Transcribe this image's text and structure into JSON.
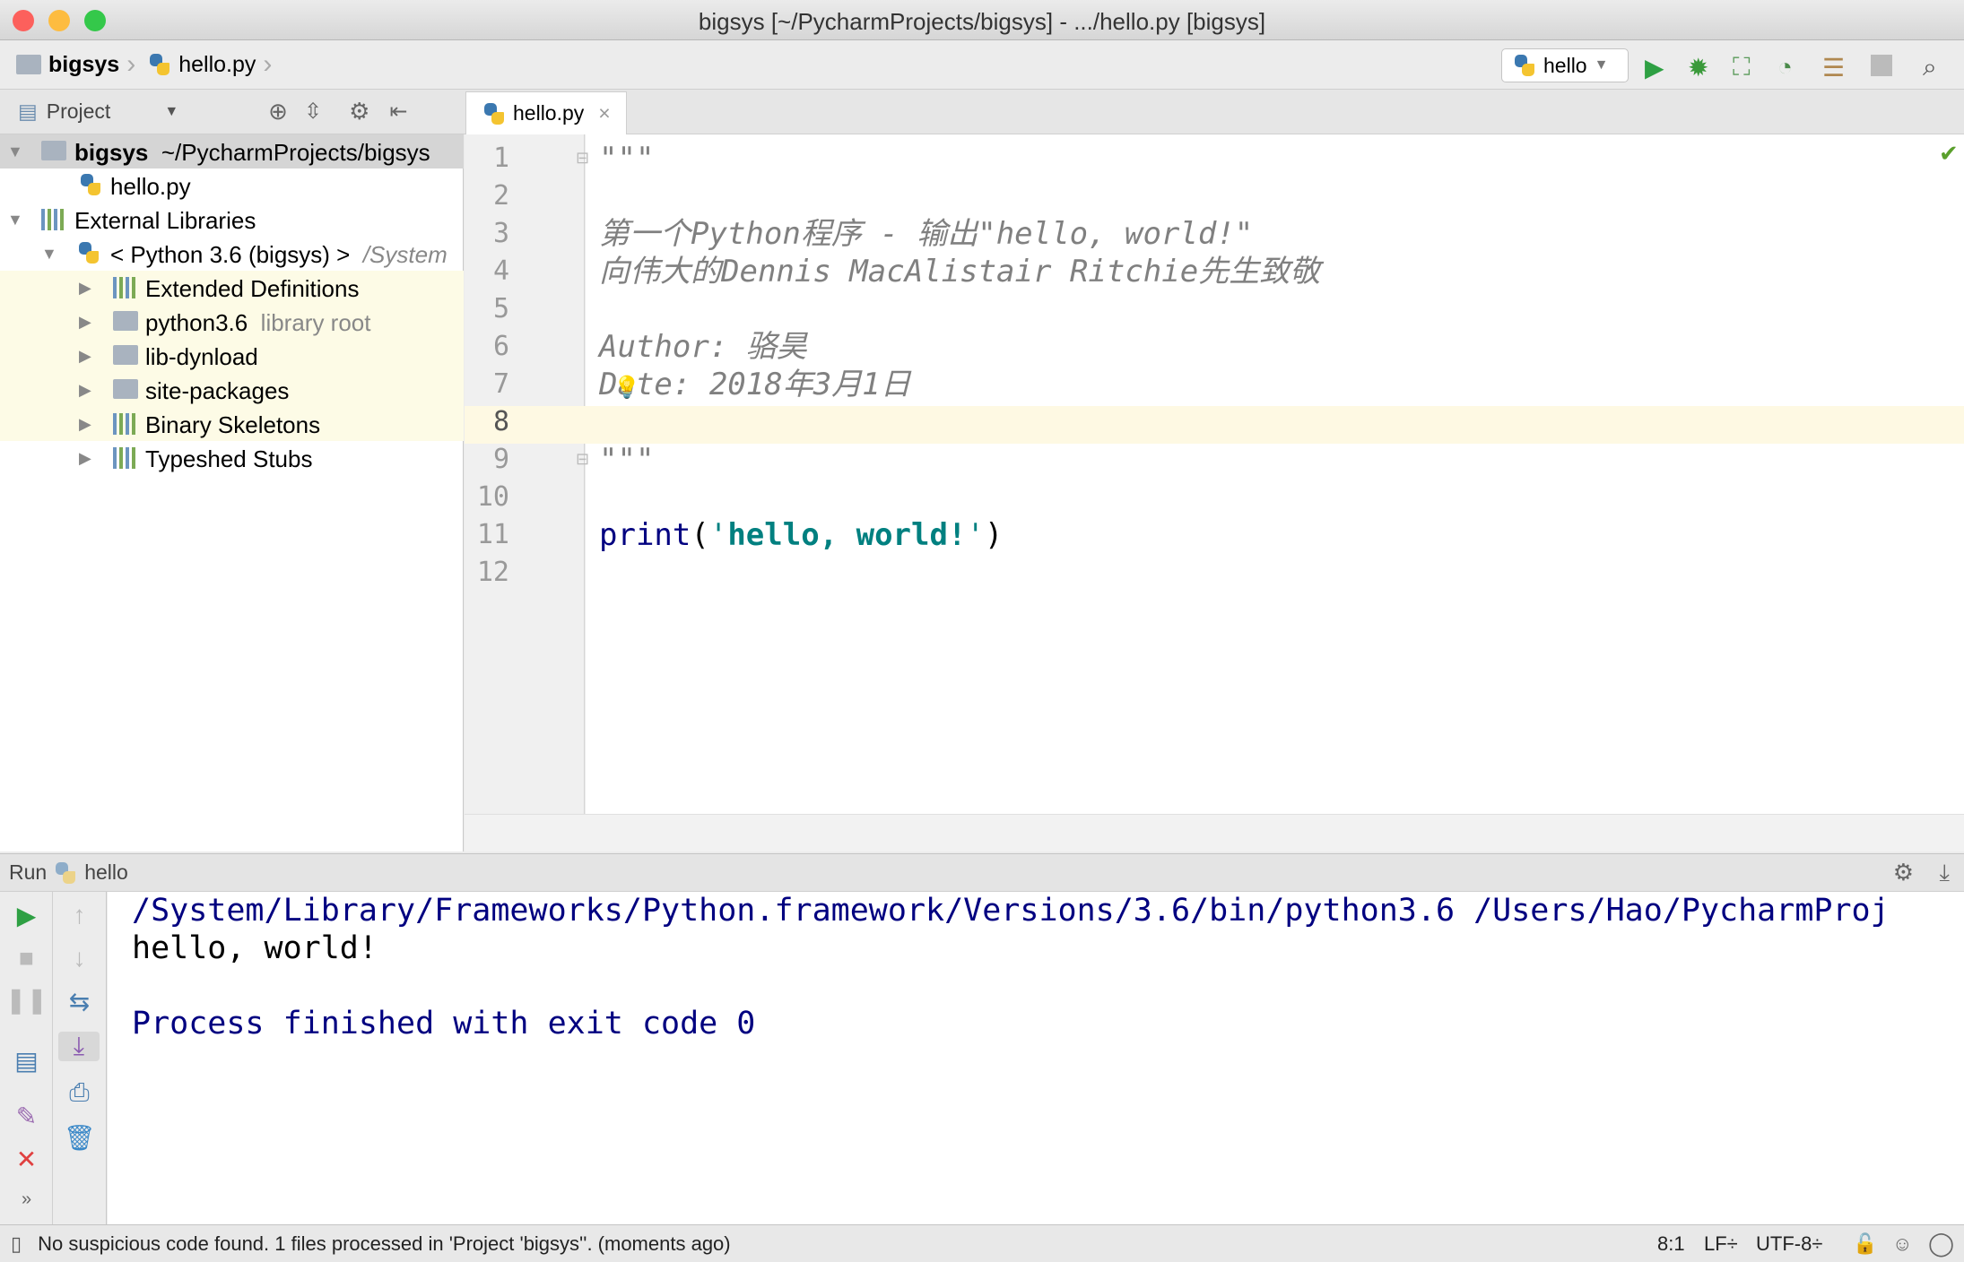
{
  "window": {
    "title": "bigsys [~/PycharmProjects/bigsys] - .../hello.py [bigsys]"
  },
  "nav": {
    "crumbs": [
      "bigsys",
      "hello.py"
    ],
    "run_config": "hello"
  },
  "sidebar": {
    "title": "Project",
    "tree": [
      {
        "label": "bigsys",
        "hint": "~/PycharmProjects/bigsys",
        "icon": "folder-icon",
        "expanded": true
      },
      {
        "label": "hello.py",
        "icon": "python-file-icon"
      },
      {
        "label": "External Libraries",
        "icon": "library-icon",
        "expanded": true
      },
      {
        "label": "< Python 3.6 (bigsys) >",
        "hint": "/System",
        "icon": "python-icon",
        "expanded": true
      },
      {
        "label": "Extended Definitions",
        "icon": "library-icon"
      },
      {
        "label": "python3.6",
        "hint": "library root",
        "icon": "folder-icon"
      },
      {
        "label": "lib-dynload",
        "icon": "folder-icon"
      },
      {
        "label": "site-packages",
        "icon": "folder-icon"
      },
      {
        "label": "Binary Skeletons",
        "icon": "library-icon"
      },
      {
        "label": "Typeshed Stubs",
        "icon": "library-icon"
      }
    ]
  },
  "editor": {
    "tab": "hello.py",
    "current_line": 8,
    "lines": [
      "\"\"\"",
      "",
      "第一个Python程序 - 输出\"hello, world!\"",
      "向伟大的Dennis MacAlistair Ritchie先生致敬",
      "",
      "Author: 骆昊",
      "Date: 2018年3月1日",
      "",
      "\"\"\"",
      "",
      "print('hello, world!')",
      ""
    ],
    "line11": {
      "fn": "print",
      "open": "(",
      "q1": "'",
      "str": "hello, world!",
      "q2": "'",
      "close": ")"
    }
  },
  "run": {
    "label": "Run",
    "config": "hello",
    "output": [
      "/System/Library/Frameworks/Python.framework/Versions/3.6/bin/python3.6 /Users/Hao/PycharmProj",
      "hello, world!",
      "",
      "Process finished with exit code 0"
    ]
  },
  "status": {
    "message": "No suspicious code found. 1 files processed in 'Project 'bigsys''. (moments ago)",
    "position": "8:1",
    "line_sep": "LF÷",
    "encoding": "UTF-8÷"
  },
  "colors": {
    "keyword": "#000080",
    "string": "#008080",
    "doc": "#808080",
    "console_system": "#000080",
    "current_line": "#fef9e3"
  }
}
